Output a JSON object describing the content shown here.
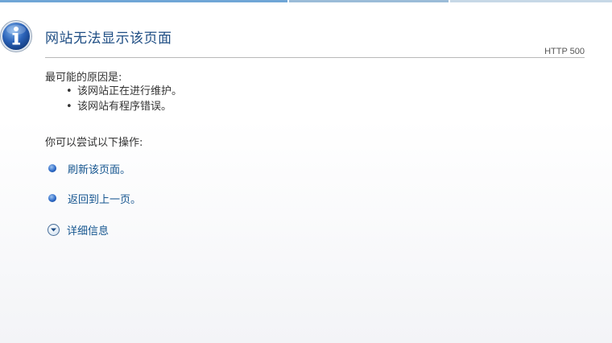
{
  "page": {
    "title": "网站无法显示该页面",
    "http_code": "HTTP 500"
  },
  "reasons": {
    "heading": "最可能的原因是:",
    "items": [
      "该网站正在进行维护。",
      "该网站有程序错误。"
    ]
  },
  "actions": {
    "heading": "你可以尝试以下操作:",
    "refresh_label": "刷新该页面。",
    "back_label": "返回到上一页。",
    "details_label": "详细信息"
  },
  "icons": {
    "info": "info-icon",
    "bullet_orb": "bullet-orb-icon",
    "expand": "chevron-down-icon"
  },
  "colors": {
    "title": "#1f4e84",
    "link": "#15558f",
    "icon_blue": "#2a62b8"
  }
}
